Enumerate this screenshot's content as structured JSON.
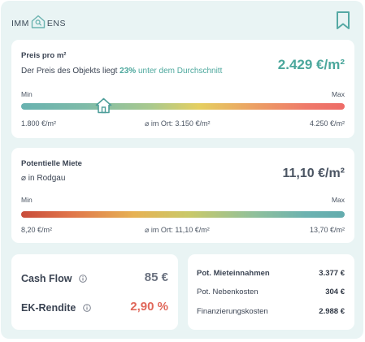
{
  "header": {
    "logo_left": "IMM",
    "logo_right": "ENS",
    "logo_icon": "house-search-icon",
    "bookmark_icon": "bookmark-icon"
  },
  "price_card": {
    "title": "Preis pro m²",
    "desc_before": "Der Preis des Objekts liegt ",
    "desc_percent": "23%",
    "desc_after": " unter dem Durchschnitt",
    "value": "2.429 €/m²",
    "min_label": "Min",
    "max_label": "Max",
    "min_value": "1.800 €/m²",
    "avg_value": "⌀ im Ort: 3.150 €/m²",
    "max_value": "4.250 €/m²",
    "marker_position": 0.26,
    "colors": {
      "accent": "#4ba79c"
    }
  },
  "rent_card": {
    "title": "Potentielle Miete",
    "subtitle": "⌀ in Rodgau",
    "value": "11,10 €/m²",
    "min_label": "Min",
    "max_label": "Max",
    "min_value": "8,20 €/m²",
    "avg_value": "⌀ im Ort: 11,10 €/m²",
    "max_value": "13,70 €/m²"
  },
  "kpis": {
    "cashflow_label": "Cash Flow",
    "cashflow_value": "85 €",
    "ek_label": "EK-Rendite",
    "ek_value": "2,90 %",
    "colors": {
      "negative": "#e0675a"
    }
  },
  "financials": {
    "rows": [
      {
        "label": "Pot. Mieteinnahmen",
        "value": "3.377 €"
      },
      {
        "label": "Pot. Nebenkosten",
        "value": "304 €"
      },
      {
        "label": "Finanzierungskosten",
        "value": "2.988 €"
      }
    ]
  }
}
